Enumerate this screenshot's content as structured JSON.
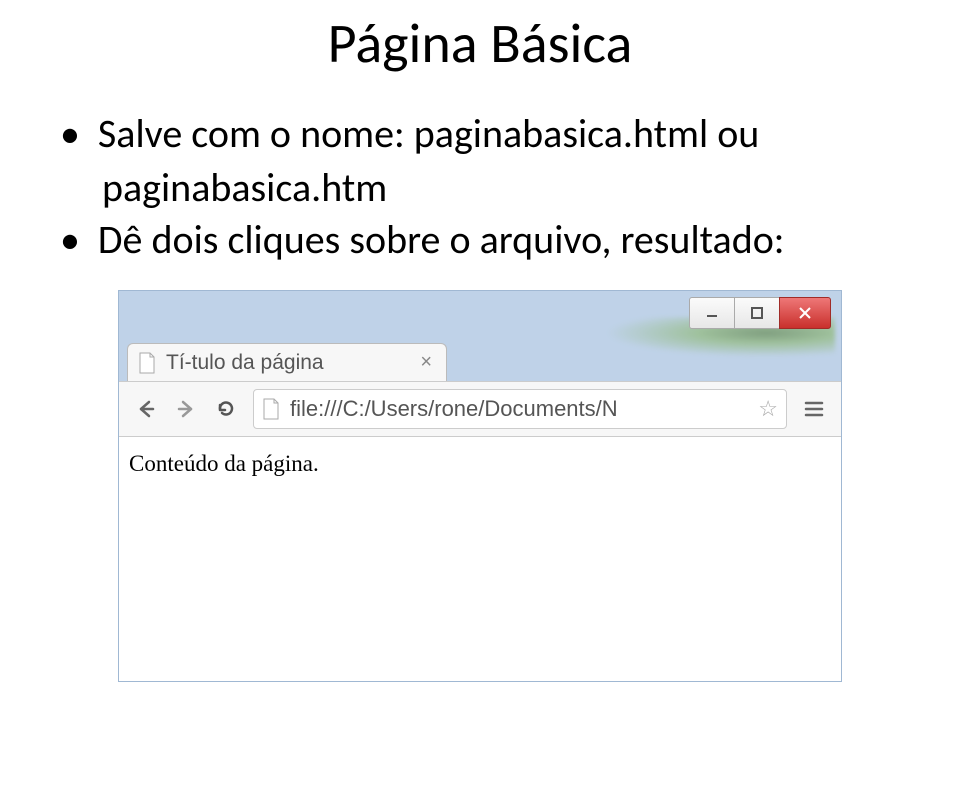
{
  "slide": {
    "title": "Página Básica",
    "bullet1_line1": "Salve com o nome: paginabasica.html ou",
    "bullet1_line2": "paginabasica.htm",
    "bullet2": "Dê dois cliques sobre o arquivo, resultado:"
  },
  "browser": {
    "tab_title": "Tí-tulo da página",
    "tab_close": "×",
    "url": "file:///C:/Users/rone/Documents/N",
    "page_content": "Conteúdo da página.",
    "win_min": "—",
    "win_max": "▢",
    "win_close": "X",
    "back": "←",
    "forward": "→",
    "reload": "↻",
    "star": "☆",
    "menu": "≡"
  }
}
